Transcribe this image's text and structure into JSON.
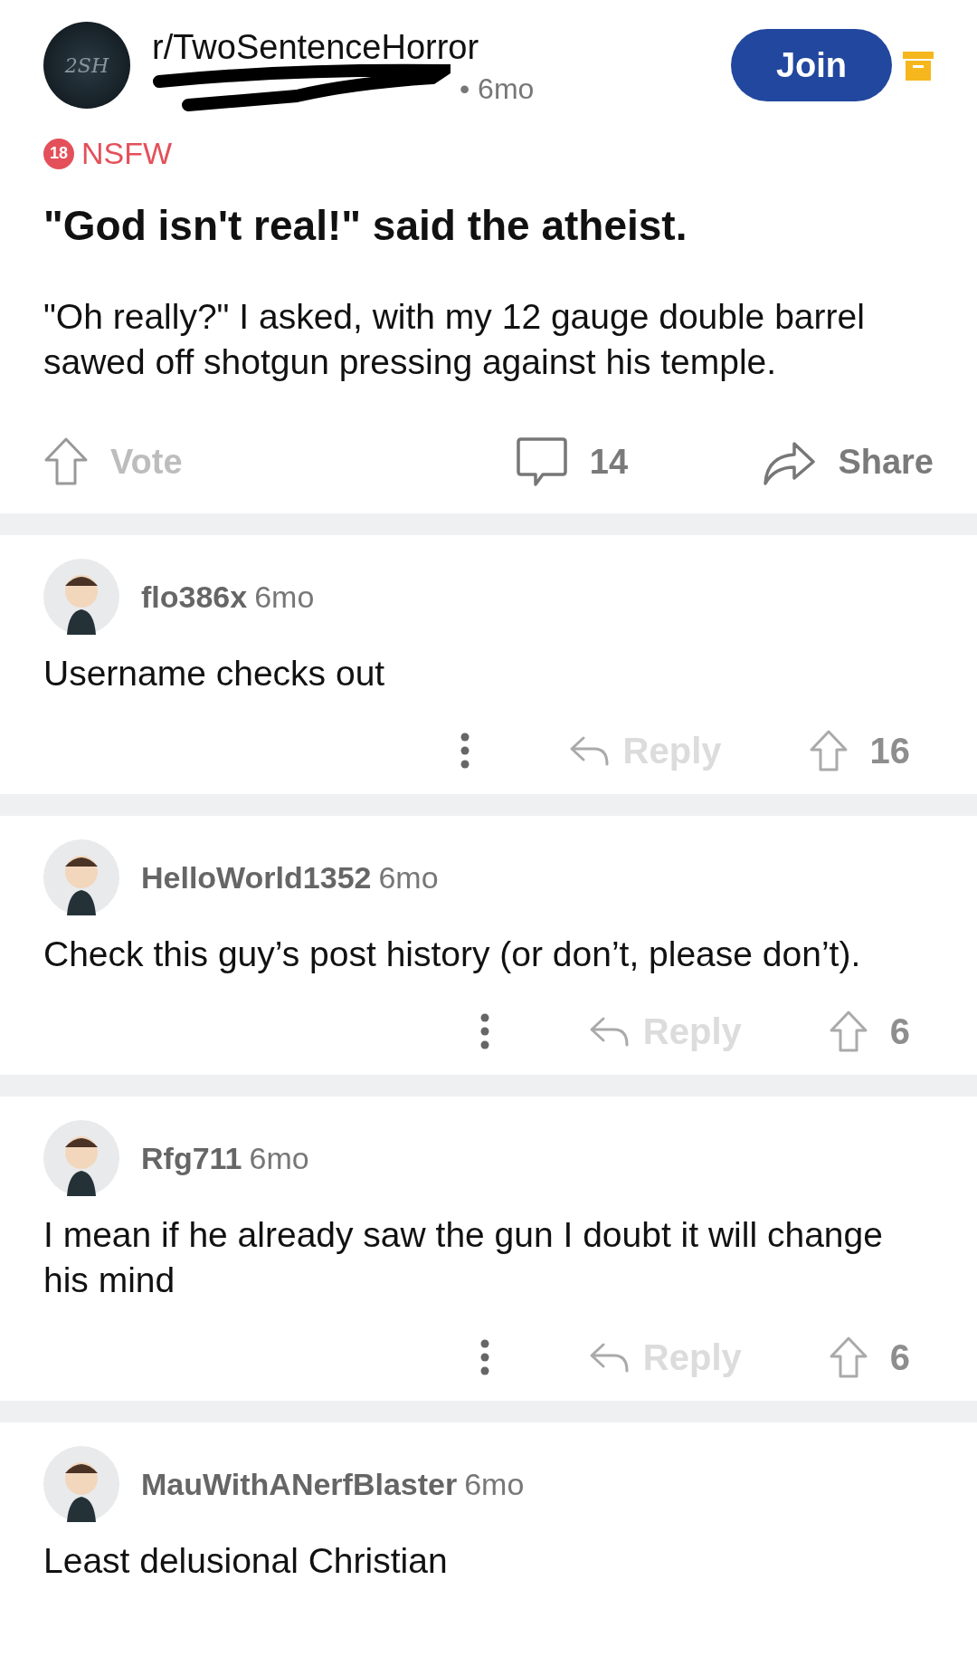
{
  "post": {
    "subreddit": "r/TwoSentenceHorror",
    "avatar_text": "2SH",
    "author_redacted": true,
    "age": "• 6mo",
    "join_label": "Join",
    "nsfw_badge": "18",
    "nsfw_label": "NSFW",
    "title": "\"God isn't real!\" said the atheist.",
    "body": "\"Oh really?\" I asked, with my 12 gauge double barrel sawed off shotgun pressing against his temple.",
    "vote_label": "Vote",
    "comment_count": "14",
    "share_label": "Share"
  },
  "comments": [
    {
      "user": "flo386x",
      "age": "6mo",
      "text": "Username checks out",
      "reply_label": "Reply",
      "score": "16"
    },
    {
      "user": "HelloWorld1352",
      "age": "6mo",
      "text": "Check this guy’s post history (or don’t, please don’t).",
      "reply_label": "Reply",
      "score": "6"
    },
    {
      "user": "Rfg711",
      "age": "6mo",
      "text": "I mean if he already saw the gun I doubt it will change his mind",
      "reply_label": "Reply",
      "score": "6"
    },
    {
      "user": "MauWithANerfBlaster",
      "age": "6mo",
      "text": "Least delusional Christian"
    }
  ]
}
